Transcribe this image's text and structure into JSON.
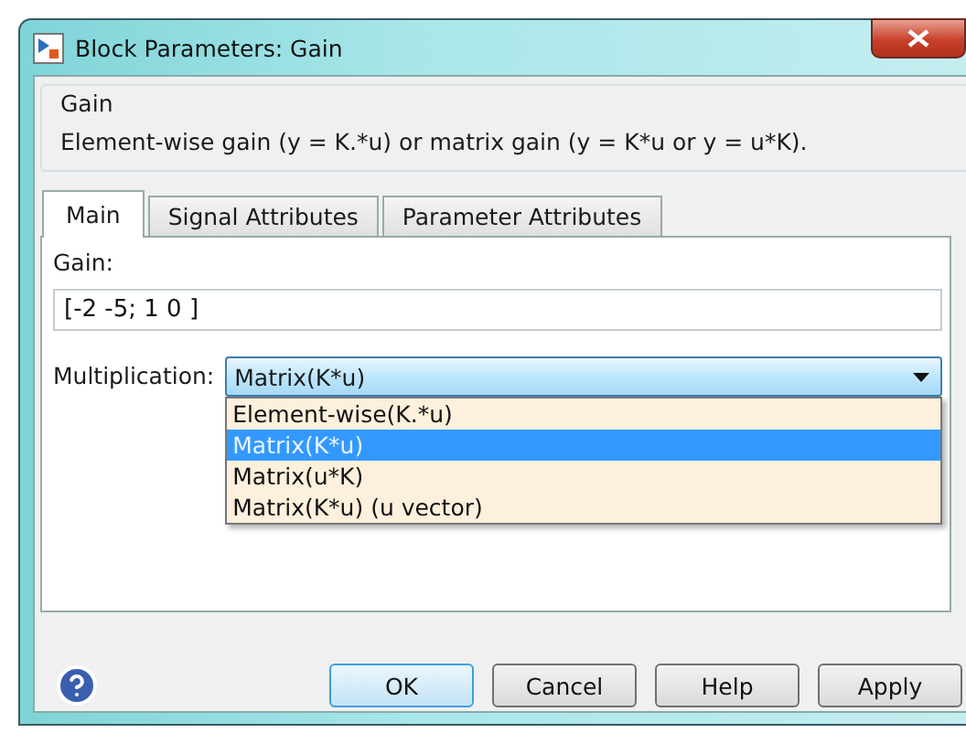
{
  "window": {
    "title": "Block Parameters: Gain"
  },
  "group": {
    "title": "Gain",
    "description": "Element-wise gain (y = K.*u) or matrix gain (y = K*u or y = u*K)."
  },
  "tabs": [
    {
      "label": "Main",
      "selected": true
    },
    {
      "label": "Signal Attributes",
      "selected": false
    },
    {
      "label": "Parameter Attributes",
      "selected": false
    }
  ],
  "gain": {
    "label": "Gain:",
    "value": "[-2 -5; 1 0 ]"
  },
  "multiplication": {
    "label": "Multiplication:",
    "value": "Matrix(K*u)",
    "expanded": true,
    "options": [
      {
        "label": "Element-wise(K.*u)",
        "selected": false
      },
      {
        "label": "Matrix(K*u)",
        "selected": true
      },
      {
        "label": "Matrix(u*K)",
        "selected": false
      },
      {
        "label": "Matrix(K*u) (u vector)",
        "selected": false
      }
    ]
  },
  "buttons": [
    {
      "label": "OK",
      "default": true
    },
    {
      "label": "Cancel",
      "default": false
    },
    {
      "label": "Help",
      "default": false
    },
    {
      "label": "Apply",
      "default": false
    }
  ]
}
